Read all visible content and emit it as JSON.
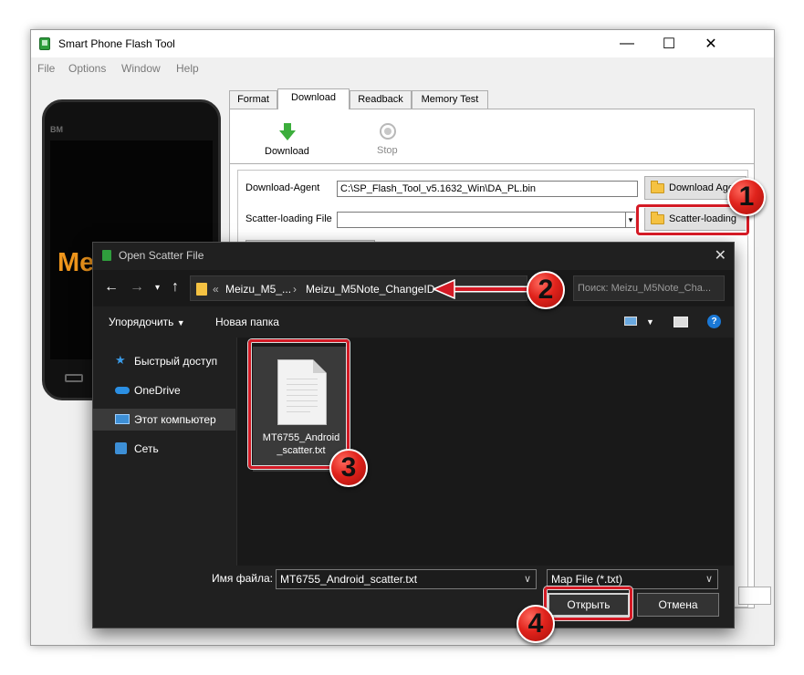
{
  "window": {
    "title": "Smart Phone Flash Tool",
    "minimize": "—",
    "maximize": "☐",
    "close": "✕"
  },
  "menu": [
    "File",
    "Options",
    "Window",
    "Help"
  ],
  "phone": {
    "brand": "BM",
    "logo": "Me"
  },
  "tabs": [
    "Format",
    "Download",
    "Readback",
    "Memory Test"
  ],
  "active_tab": "Download",
  "toolbar": {
    "download": "Download",
    "stop": "Stop"
  },
  "config": {
    "download_agent_label": "Download-Agent",
    "download_agent_value": "C:\\SP_Flash_Tool_v5.1632_Win\\DA_PL.bin",
    "download_agent_button": "Download Agent",
    "scatter_label": "Scatter-loading File",
    "scatter_value": "",
    "scatter_button": "Scatter-loading"
  },
  "dialog": {
    "title": "Open Scatter File",
    "close": "✕",
    "breadcrumb": [
      "Meizu_M5_...",
      "Meizu_M5Note_ChangeID"
    ],
    "breadcrumb_prefix": "«",
    "search_placeholder": "Поиск: Meizu_M5Note_Cha...",
    "commands": {
      "organize": "Упорядочить",
      "new_folder": "Новая папка"
    },
    "nav": [
      "Быстрый доступ",
      "OneDrive",
      "Этот компьютер",
      "Сеть"
    ],
    "selected_nav": "Этот компьютер",
    "file": {
      "name_line1": "MT6755_Android",
      "name_line2": "_scatter.txt"
    },
    "filename_label": "Имя файла:",
    "filename_value": "MT6755_Android_scatter.txt",
    "filetype_value": "Map File (*.txt)",
    "open_button": "Открыть",
    "cancel_button": "Отмена"
  },
  "annotations": [
    "1",
    "2",
    "3",
    "4"
  ],
  "colors": {
    "highlight": "#d41a25",
    "dialog_bg": "#202020",
    "download_arrow": "#3cae3c",
    "folder": "#f5c242",
    "onedrive": "#2b8fe3"
  }
}
